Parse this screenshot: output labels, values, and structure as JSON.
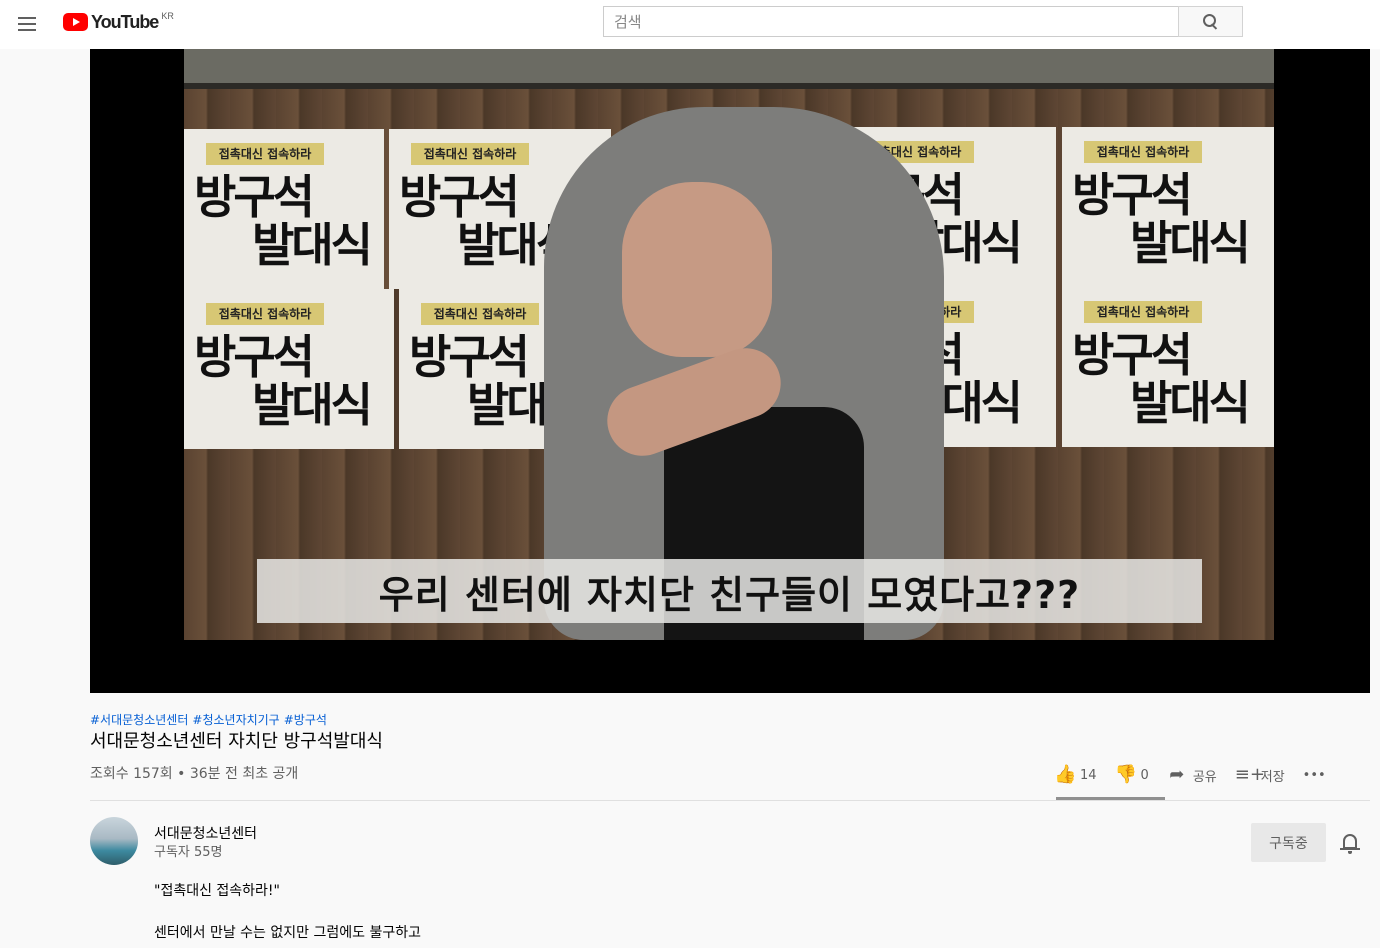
{
  "header": {
    "logo_text": "YouTube",
    "region": "KR",
    "search_placeholder": "검색"
  },
  "video": {
    "subtitle_caption": "우리 센터에 자치단 친구들이 모였다고???",
    "poster_tape": "접촉대신 접속하라",
    "poster_line1": "방구석",
    "poster_line2": "발대식"
  },
  "meta": {
    "hashtags": [
      "#서대문청소년센터",
      "#청소년자치기구",
      "#방구석"
    ],
    "title": "서대문청소년센터 자치단 방구석발대식",
    "views": "조회수 157회 • 36분 전 최초 공개"
  },
  "actions": {
    "like_count": "14",
    "dislike_count": "0",
    "share_label": "공유",
    "save_label": "저장",
    "more_label": "•••"
  },
  "channel": {
    "name": "서대문청소년센터",
    "subscribers": "구독자 55명",
    "subscribe_label": "구독중"
  },
  "description": {
    "line1": "\"접촉대신 접속하라!\"",
    "line2": "센터에서 만날 수는 없지만 그럼에도 불구하고"
  },
  "colors": {
    "accent_red": "#ff0000",
    "link_blue": "#065fd4",
    "tape_yellow": "#d7c774"
  },
  "icons": [
    "menu-icon",
    "youtube-logo-icon",
    "search-icon",
    "thumbs-up-icon",
    "thumbs-down-icon",
    "share-icon",
    "save-playlist-icon",
    "more-icon",
    "bell-icon"
  ]
}
